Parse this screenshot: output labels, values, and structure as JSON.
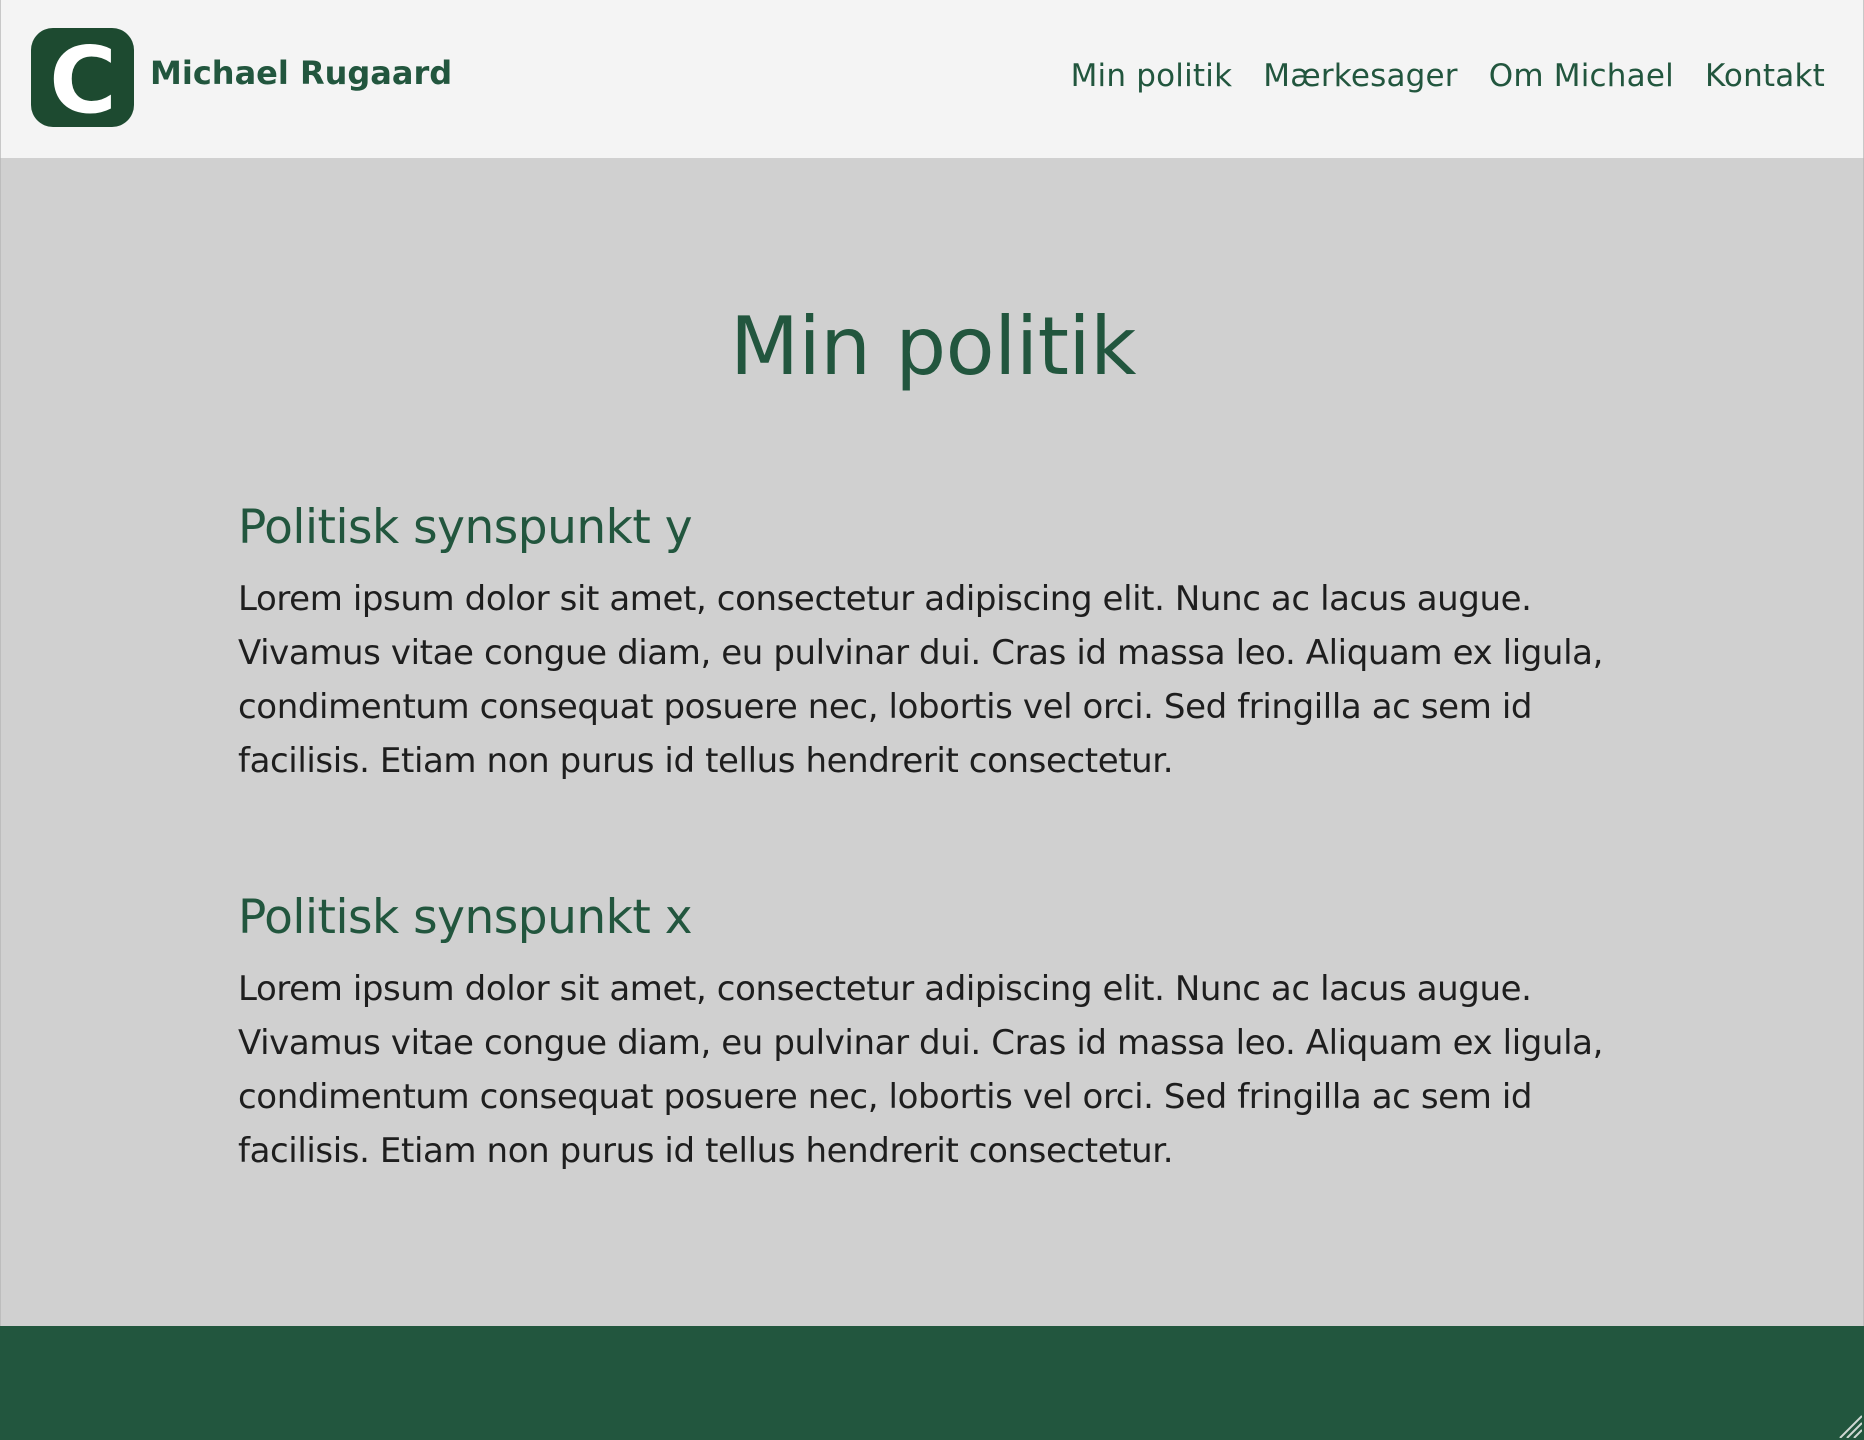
{
  "header": {
    "brand_name": "Michael Rugaard",
    "logo_letter": "C",
    "nav": [
      {
        "label": "Min politik"
      },
      {
        "label": "Mærkesager"
      },
      {
        "label": "Om Michael"
      },
      {
        "label": "Kontakt"
      }
    ]
  },
  "main": {
    "title": "Min politik",
    "sections": [
      {
        "heading": "Politisk synspunkt y",
        "body": "Lorem ipsum dolor sit amet, consectetur adipiscing elit. Nunc ac lacus augue. Vivamus vitae congue diam, eu pulvinar dui. Cras id massa leo. Aliquam ex ligula, condimentum consequat posuere nec, lobortis vel orci. Sed fringilla ac sem id facilisis. Etiam non purus id tellus hendrerit consectetur."
      },
      {
        "heading": "Politisk synspunkt x",
        "body": "Lorem ipsum dolor sit amet, consectetur adipiscing elit. Nunc ac lacus augue. Vivamus vitae congue diam, eu pulvinar dui. Cras id massa leo. Aliquam ex ligula, condimentum consequat posuere nec, lobortis vel orci. Sed fringilla ac sem id facilisis. Etiam non purus id tellus hendrerit consectetur."
      }
    ]
  },
  "colors": {
    "brand_green": "#22563e",
    "logo_green": "#1d4a30",
    "header_bg": "#f4f4f4",
    "main_bg": "#d0d0d0",
    "text": "#1e1e1e"
  },
  "icons": {
    "logo": "c-logo-icon",
    "resize": "resize-grip-icon"
  }
}
